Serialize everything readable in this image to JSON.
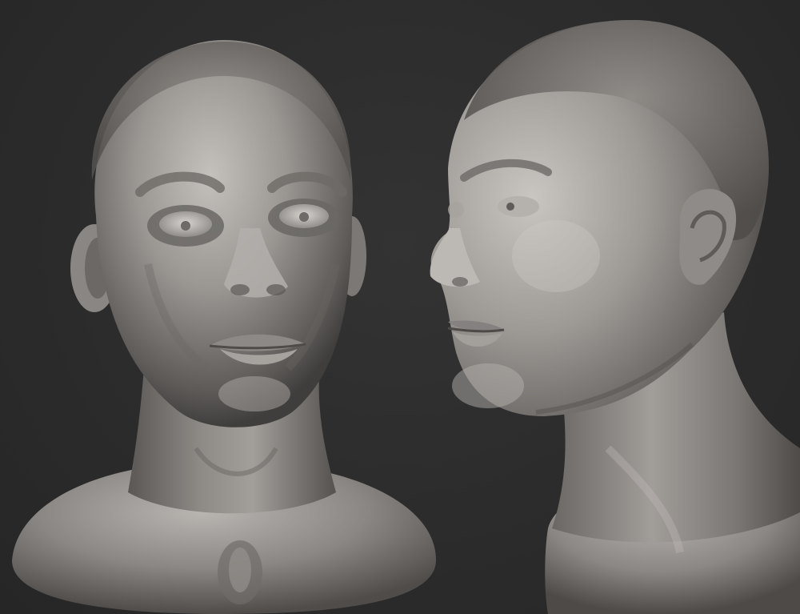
{
  "viewport": {
    "background_color": "#2c2c2c",
    "clay_color": "#8a8683",
    "clay_highlight": "#c9c5c1",
    "clay_shadow": "#3a3837"
  },
  "views": [
    {
      "name": "front-view",
      "icon": "sculpt-bust-front"
    },
    {
      "name": "side-view",
      "icon": "sculpt-bust-three-quarter"
    }
  ]
}
